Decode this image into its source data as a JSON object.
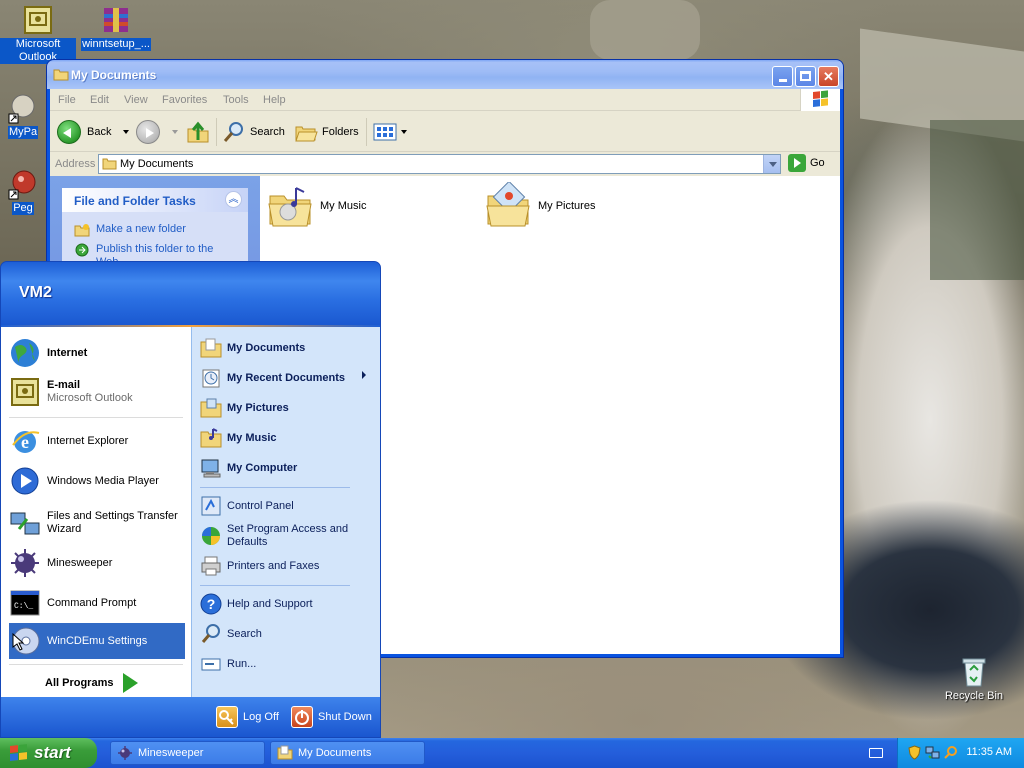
{
  "desktop": {
    "icons": [
      {
        "label": "Microsoft Outlook"
      },
      {
        "label": "winntsetup_..."
      },
      {
        "label": "MyPa"
      },
      {
        "label": "Peg"
      },
      {
        "label": "Recycle Bin"
      }
    ]
  },
  "explorer": {
    "title": "My Documents",
    "menu": [
      "File",
      "Edit",
      "View",
      "Favorites",
      "Tools",
      "Help"
    ],
    "toolbar": {
      "back": "Back",
      "search": "Search",
      "folders": "Folders"
    },
    "address": {
      "label": "Address",
      "value": "My Documents",
      "go": "Go"
    },
    "tasks": {
      "title": "File and Folder Tasks",
      "links": [
        "Make a new folder",
        "Publish this folder to the Web"
      ]
    },
    "items": [
      {
        "name": "My Music"
      },
      {
        "name": "My Pictures"
      }
    ]
  },
  "start_menu": {
    "user": "VM2",
    "pinned": [
      {
        "title": "Internet",
        "sub": ""
      },
      {
        "title": "E-mail",
        "sub": "Microsoft Outlook"
      }
    ],
    "recent": [
      "Internet Explorer",
      "Windows Media Player",
      "Files and Settings Transfer Wizard",
      "Minesweeper",
      "Command Prompt",
      "WinCDEmu Settings"
    ],
    "all_programs": "All Programs",
    "places": [
      "My Documents",
      "My Recent Documents",
      "My Pictures",
      "My Music",
      "My Computer"
    ],
    "system": [
      "Control Panel",
      "Set Program Access and Defaults",
      "Printers and Faxes"
    ],
    "help": [
      "Help and Support",
      "Search",
      "Run..."
    ],
    "log_off": "Log Off",
    "shut_down": "Shut Down"
  },
  "taskbar": {
    "start": "start",
    "tasks": [
      "Minesweeper",
      "My Documents"
    ],
    "clock": "11:35 AM"
  }
}
